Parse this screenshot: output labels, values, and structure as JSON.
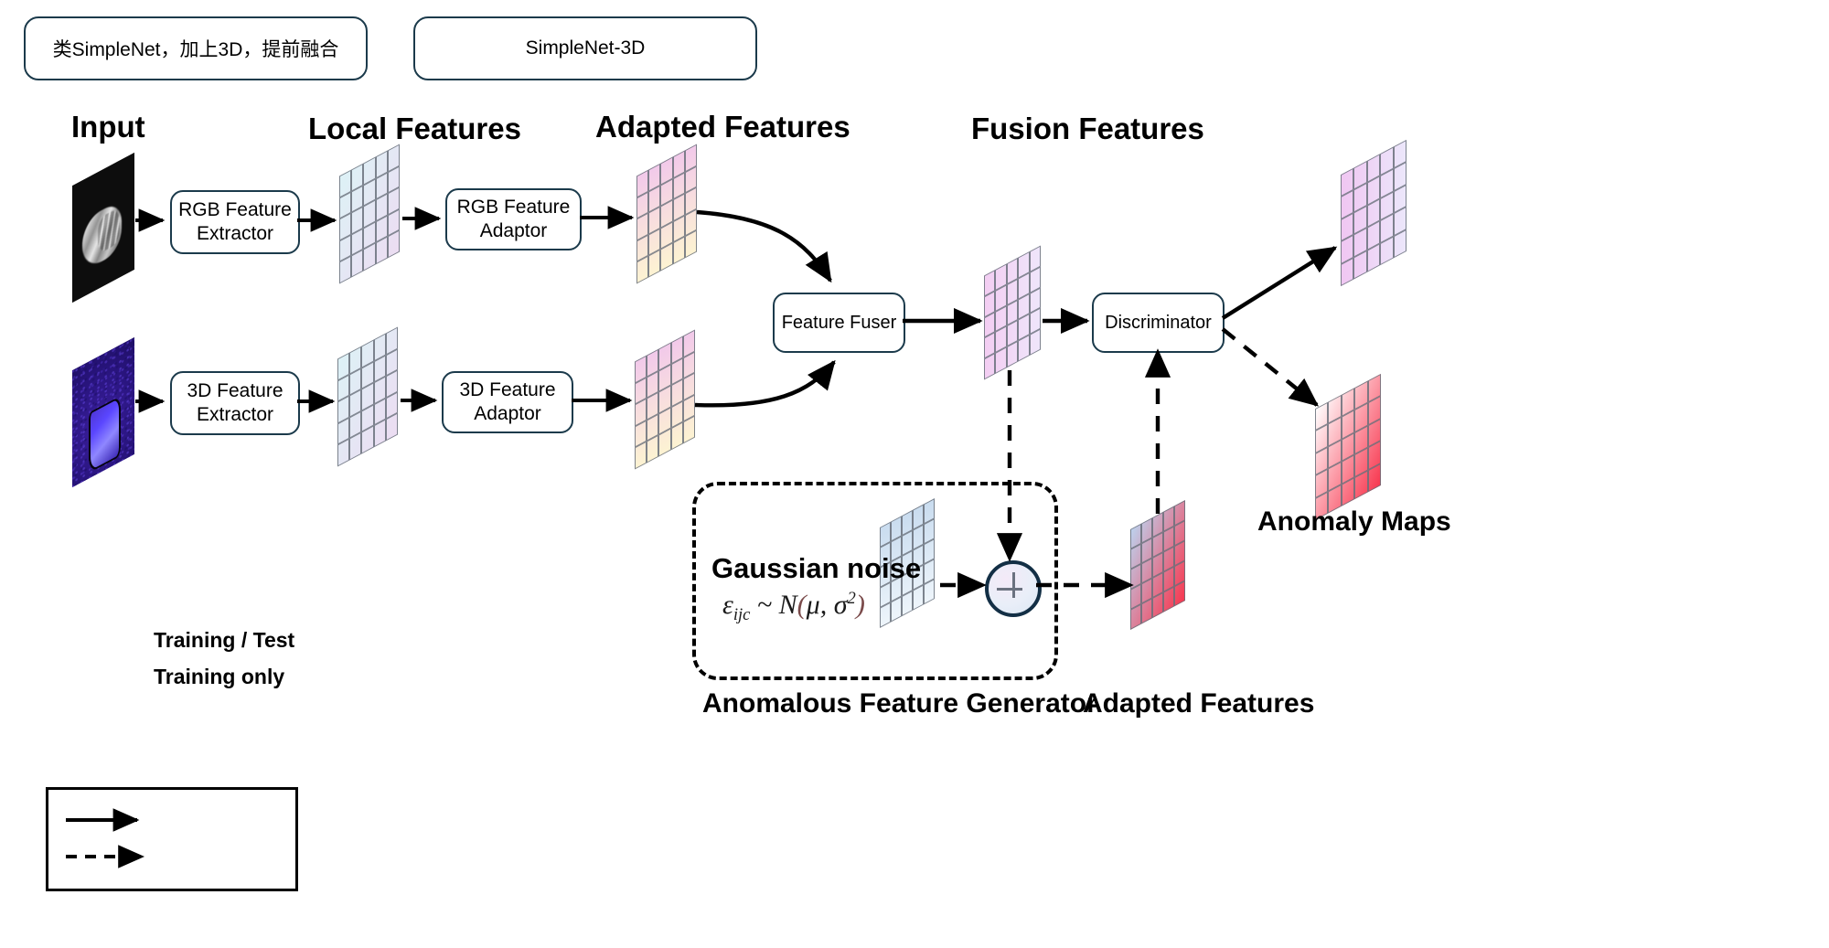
{
  "notes": [
    {
      "id": "note-cn",
      "text": "类SimpleNet，加上3D，提前融合"
    },
    {
      "id": "note-en",
      "text": "SimpleNet-3D"
    }
  ],
  "headings": {
    "input": "Input",
    "local_features": "Local Features",
    "adapted_features": "Adapted Features",
    "fusion_features": "Fusion Features"
  },
  "boxes": {
    "rgb_extractor": "RGB Feature\nExtractor",
    "rgb_adaptor": "RGB Feature\nAdaptor",
    "d3_extractor": "3D Feature\nExtractor",
    "d3_adaptor": "3D Feature\nAdaptor",
    "feature_fuser": "Feature Fuser",
    "discriminator": "Discriminator"
  },
  "generator": {
    "gaussian_label": "Gaussian noise",
    "formula_eps": "ε",
    "formula_sub": "ijc",
    "formula_tilde": " ~ ",
    "formula_n": "N",
    "formula_open": "(",
    "formula_mu": "μ",
    "formula_comma": ", ",
    "formula_sigma": "σ",
    "formula_pow": "2",
    "formula_close": ")",
    "caption": "Anomalous Feature Generator",
    "plus_symbol": "+"
  },
  "bottom_labels": {
    "adapted_features": "Adapted Features",
    "anomaly_maps": "Anomaly Maps"
  },
  "legend": {
    "solid": "Training / Test",
    "dashed": "Training only"
  },
  "colors": {
    "box_border": "#1b3a4b",
    "arrow": "#000000",
    "local_feature_a": "#ddf2f6",
    "local_feature_b": "#ecdcf2",
    "adapted_feature_a": "#f2c9ea",
    "adapted_feature_b": "#fdf3d2",
    "fusion_feature_a": "#f3cdf2",
    "fusion_feature_b": "#efe6fb",
    "noise_grid_a": "#c9dcef",
    "noise_grid_b": "#eef5fb",
    "anomaly_normal_a": "#f0c6f2",
    "anomaly_normal_b": "#ece7fb",
    "anomaly_defect_a": "#f8364e",
    "anomaly_defect_b": "#ffffff",
    "rgb_input_bg": "#0d0d0d",
    "depth_input_bg": "#2a1580",
    "plus_border": "#132f45"
  }
}
